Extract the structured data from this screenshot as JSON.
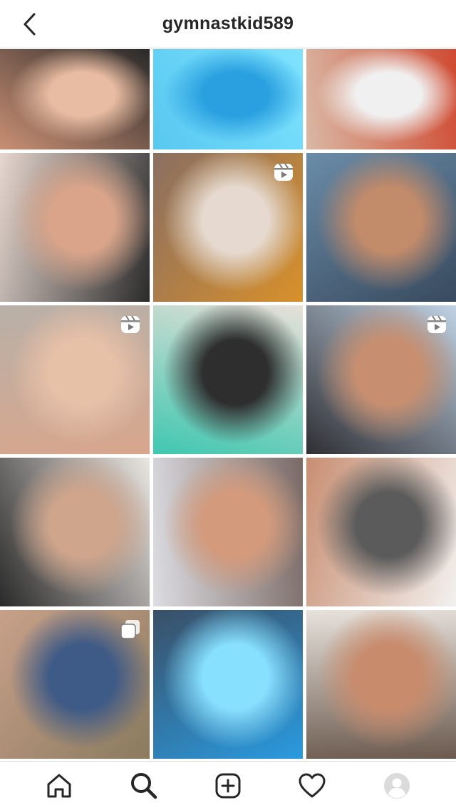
{
  "header": {
    "username": "gymnastkid589",
    "back_icon": "chevron-left-icon"
  },
  "grid": {
    "tiles": [
      {
        "index": 1,
        "badge": null,
        "colors": [
          "#c98f73",
          "#e8bca2",
          "#2a2a2a"
        ]
      },
      {
        "index": 2,
        "badge": null,
        "colors": [
          "#58c8f0",
          "#2aa0e0",
          "#7fe3ff"
        ]
      },
      {
        "index": 3,
        "badge": null,
        "colors": [
          "#d9b8a4",
          "#f0f0f0",
          "#d04a32"
        ]
      },
      {
        "index": 4,
        "badge": null,
        "colors": [
          "#e6d7cf",
          "#d9a48a",
          "#2b2b2b"
        ]
      },
      {
        "index": 5,
        "badge": "reel-icon",
        "colors": [
          "#8a6f62",
          "#e6dad0",
          "#d8902a"
        ]
      },
      {
        "index": 6,
        "badge": null,
        "colors": [
          "#6a8ca8",
          "#c28b6a",
          "#384a5e"
        ]
      },
      {
        "index": 7,
        "badge": "reel-icon",
        "colors": [
          "#b8b0a8",
          "#e7c0a8",
          "#d8a68c"
        ]
      },
      {
        "index": 8,
        "badge": null,
        "colors": [
          "#e8e0d8",
          "#2e2e2e",
          "#3fc7b0"
        ]
      },
      {
        "index": 9,
        "badge": "reel-icon",
        "colors": [
          "#bfd2e4",
          "#c78f70",
          "#2f2f34"
        ]
      },
      {
        "index": 10,
        "badge": null,
        "colors": [
          "#eae6e2",
          "#cfa58c",
          "#2a2a2a"
        ]
      },
      {
        "index": 11,
        "badge": null,
        "colors": [
          "#7a6a66",
          "#d39a7c",
          "#dcdde2"
        ]
      },
      {
        "index": 12,
        "badge": null,
        "colors": [
          "#f3f1ef",
          "#5b5b5b",
          "#c88e72"
        ]
      },
      {
        "index": 13,
        "badge": "carousel-icon",
        "colors": [
          "#8a7b5e",
          "#3e5a86",
          "#c8a08a"
        ]
      },
      {
        "index": 14,
        "badge": null,
        "colors": [
          "#2a9be0",
          "#88e0ff",
          "#3a4f66"
        ]
      },
      {
        "index": 15,
        "badge": null,
        "colors": [
          "#6b5a4e",
          "#c88b6c",
          "#e7e2dc"
        ]
      }
    ]
  },
  "bottom_nav": {
    "items": [
      {
        "name": "home-icon"
      },
      {
        "name": "search-icon",
        "active": true
      },
      {
        "name": "new-post-icon"
      },
      {
        "name": "activity-heart-icon"
      },
      {
        "name": "profile-avatar-icon"
      }
    ]
  }
}
